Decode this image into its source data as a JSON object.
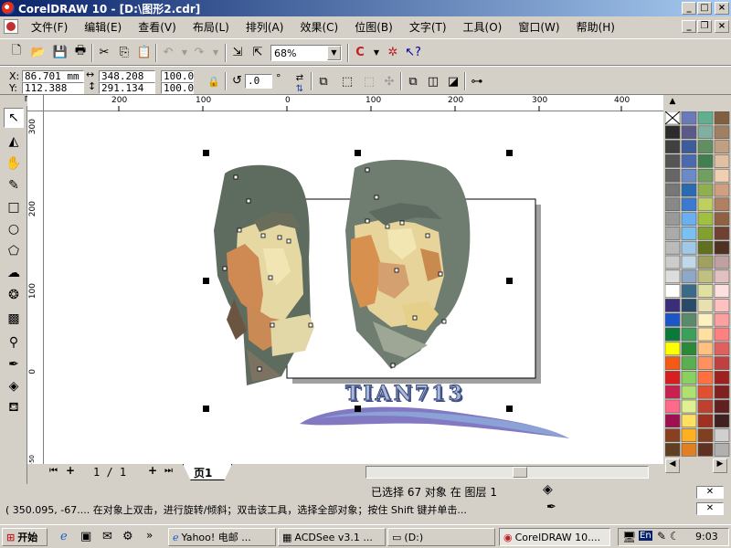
{
  "window": {
    "title": "CorelDRAW 10 - [D:\\图形2.cdr]",
    "buttons": {
      "minimize": "_",
      "maximize": "□",
      "close": "×"
    }
  },
  "menu": [
    "文件(F)",
    "编辑(E)",
    "查看(V)",
    "布局(L)",
    "排列(A)",
    "效果(C)",
    "位图(B)",
    "文字(T)",
    "工具(O)",
    "窗口(W)",
    "帮助(H)"
  ],
  "toolbar": {
    "zoom": "68%"
  },
  "property_bar": {
    "x_label": "X:",
    "y_label": "Y:",
    "x": "86.701 mm",
    "y": "112.388 mm",
    "width": "348.208 m",
    "height": "291.134 m",
    "scale_x": "100.0",
    "scale_y": "100.0",
    "rotation": ".0",
    "degree": "°"
  },
  "ruler": {
    "h_labels": [
      "200",
      "100",
      "0",
      "100",
      "200",
      "300",
      "400"
    ],
    "v_labels": [
      "300",
      "200",
      "100",
      "0",
      "-50"
    ]
  },
  "canvas": {
    "text_logo": "TIAN713"
  },
  "page_nav": {
    "position": "1 / 1",
    "tab": "页1"
  },
  "status": {
    "selection": "已选择 67 对象 在 图层 1",
    "hint": "( 350.095, -67.... 在对象上双击，进行旋转/倾斜；双击该工具，选择全部对象；按住 Shift 键并单击..."
  },
  "taskbar": {
    "start": "开始",
    "tasks": [
      "Yahoo! 电邮 ...",
      "ACDSee v3.1 ...",
      "(D:)",
      "CorelDRAW 10...."
    ],
    "clock": "9:03",
    "lang": "En"
  },
  "colors": {
    "accent": "#0a246a",
    "hair": "#6b7a6e",
    "skin1": "#e9d9a0",
    "skin2": "#d9915a"
  }
}
